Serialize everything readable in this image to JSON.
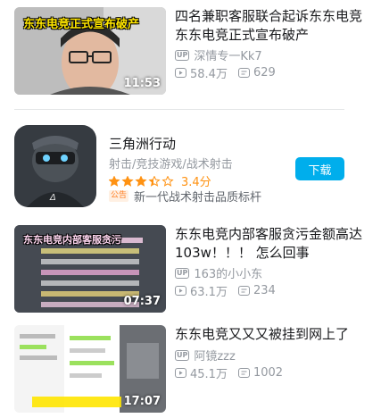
{
  "videos": [
    {
      "thumb_caption": "东东电竞正式宣布破产",
      "duration": "11:53",
      "title": "四名兼职客服联合起诉东东电竞 东东电竞正式宣布破产",
      "up_badge": "UP",
      "uploader": "深情专一Kk7",
      "views": "58.4万",
      "comments": "629"
    },
    {
      "thumb_caption": "东东电竞内部客服贪污",
      "duration": "07:37",
      "title": "东东电竞内部客服贪污金额高达103w！！！ 怎么回事",
      "up_badge": "UP",
      "uploader": "163的小小东",
      "views": "63.1万",
      "comments": "234"
    },
    {
      "thumb_caption": "",
      "duration": "17:07",
      "title": "东东电竞又又又被挂到网上了",
      "up_badge": "UP",
      "uploader": "阿镜zzz",
      "views": "45.1万",
      "comments": "1002"
    }
  ],
  "app": {
    "name": "三角洲行动",
    "tags": "射击/竞技游戏/战术射击",
    "rating": "3.4分",
    "rating_fraction": 0.68,
    "notice_tag": "公告",
    "notice": "新一代战术射击品质标杆",
    "download_label": "下载"
  },
  "colors": {
    "accent": "#00aeec",
    "rating": "#ff9212",
    "meta": "#9499a0"
  }
}
